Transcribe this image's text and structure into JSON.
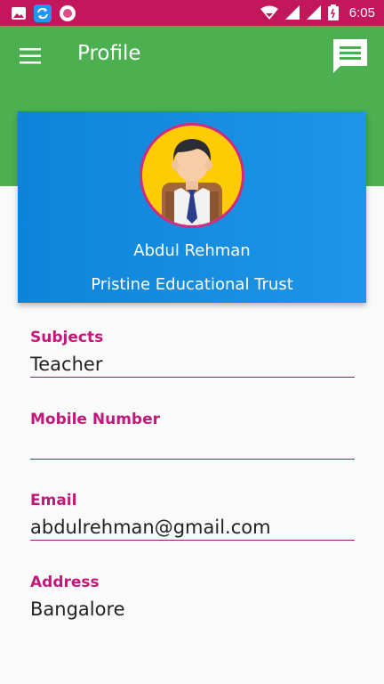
{
  "status_bar": {
    "time": "6:05",
    "icons": [
      "gallery-icon",
      "sync-icon",
      "record-icon",
      "wifi-icon",
      "signal-icon",
      "signal-icon",
      "battery-icon"
    ]
  },
  "app_bar": {
    "title": "Profile",
    "menu_icon": "hamburger-menu-icon",
    "action_icon": "chat-message-icon"
  },
  "profile": {
    "name": "Abdul Rehman",
    "organization": "Pristine Educational Trust",
    "avatar_icon": "student-avatar-icon"
  },
  "fields": {
    "subjects": {
      "label": "Subjects",
      "value": "Teacher"
    },
    "mobile": {
      "label": "Mobile Number",
      "value": ""
    },
    "email": {
      "label": "Email",
      "value": "abdulrehman@gmail.com"
    },
    "address": {
      "label": "Address",
      "value": "Bangalore"
    }
  },
  "colors": {
    "status_bar": "#c2185b",
    "app_bar": "#4caf50",
    "card": "#1b8fe0",
    "label": "#c2187a",
    "avatar_bg": "#ffcb05"
  }
}
